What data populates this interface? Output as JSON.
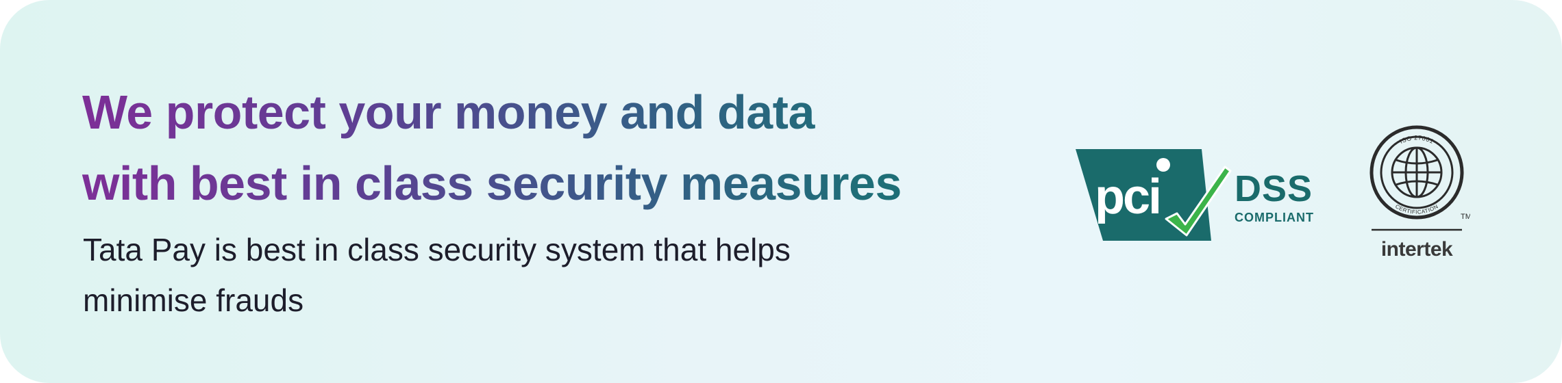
{
  "headline": {
    "line1": "We protect your money and data",
    "line2": "with best in class security measures"
  },
  "description": {
    "line1": "Tata Pay is best in class security system that helps",
    "line2": "minimise frauds"
  },
  "badges": {
    "pci": {
      "logo_text": "pci",
      "name": "DSS",
      "status": "COMPLIANT",
      "color": "#1a6b6b",
      "check_color": "#3cb44a"
    },
    "iso": {
      "standard": "ISO 27001",
      "label": "CERTIFICATION",
      "trademark": "TM",
      "brand": "intertek",
      "color": "#2b2b2b"
    }
  },
  "colors": {
    "gradient_start": "#7d2f97",
    "gradient_end": "#1a6c71",
    "background": "#e8f4f8",
    "body_text": "#1d1d2b"
  }
}
